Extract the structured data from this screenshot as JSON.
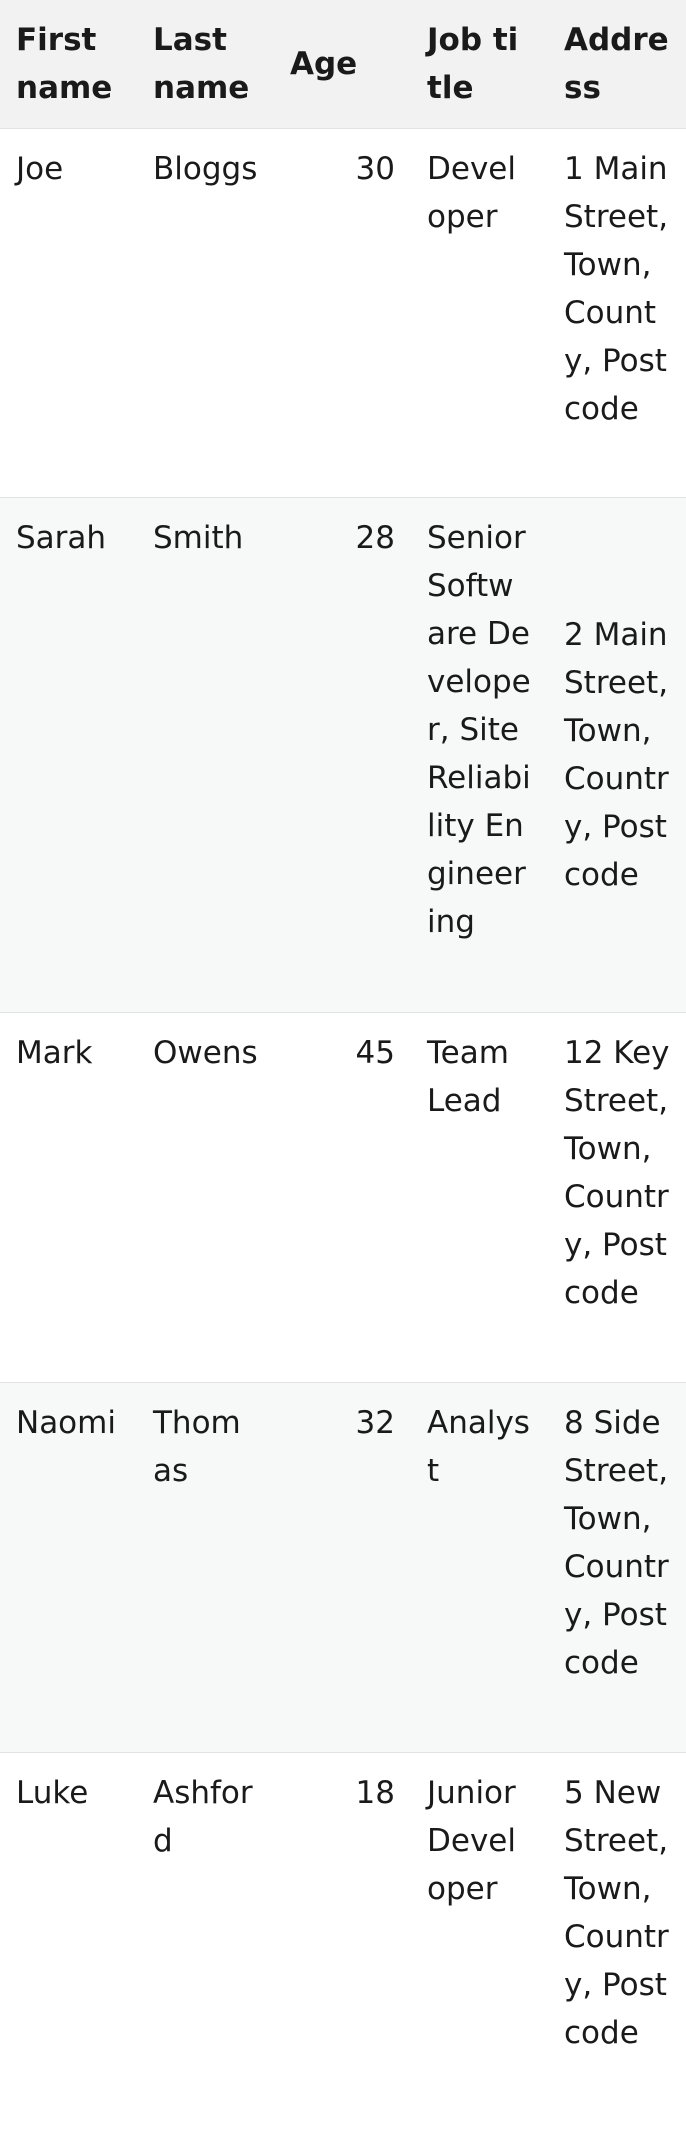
{
  "table": {
    "headers": {
      "first_name": "First name",
      "last_name": "Last name",
      "age": "Age",
      "job_title": "Job title",
      "address": "Address"
    },
    "rows": [
      {
        "first_name": "Joe",
        "last_name": "Bloggs",
        "age": "30",
        "job_title": "Developer",
        "address": "1 Main Street, Town, County, Postcode"
      },
      {
        "first_name": "Sarah",
        "last_name": "Smith",
        "age": "28",
        "job_title": "Senior Software Developer, Site Reliability Engineering",
        "address": "2 Main Street, Town, Country, Postcode"
      },
      {
        "first_name": "Mark",
        "last_name": "Owens",
        "age": "45",
        "job_title": "Team Lead",
        "address": "12 Key Street, Town, Country, Postcode"
      },
      {
        "first_name": "Naomi",
        "last_name": "Thomas",
        "age": "32",
        "job_title": "Analyst",
        "address": "8 Side Street, Town, Country, Postcode"
      },
      {
        "first_name": "Luke",
        "last_name": "Ashford",
        "age": "18",
        "job_title": "Junior Developer",
        "address": "5 New Street, Town, Country, Postcode"
      }
    ]
  }
}
